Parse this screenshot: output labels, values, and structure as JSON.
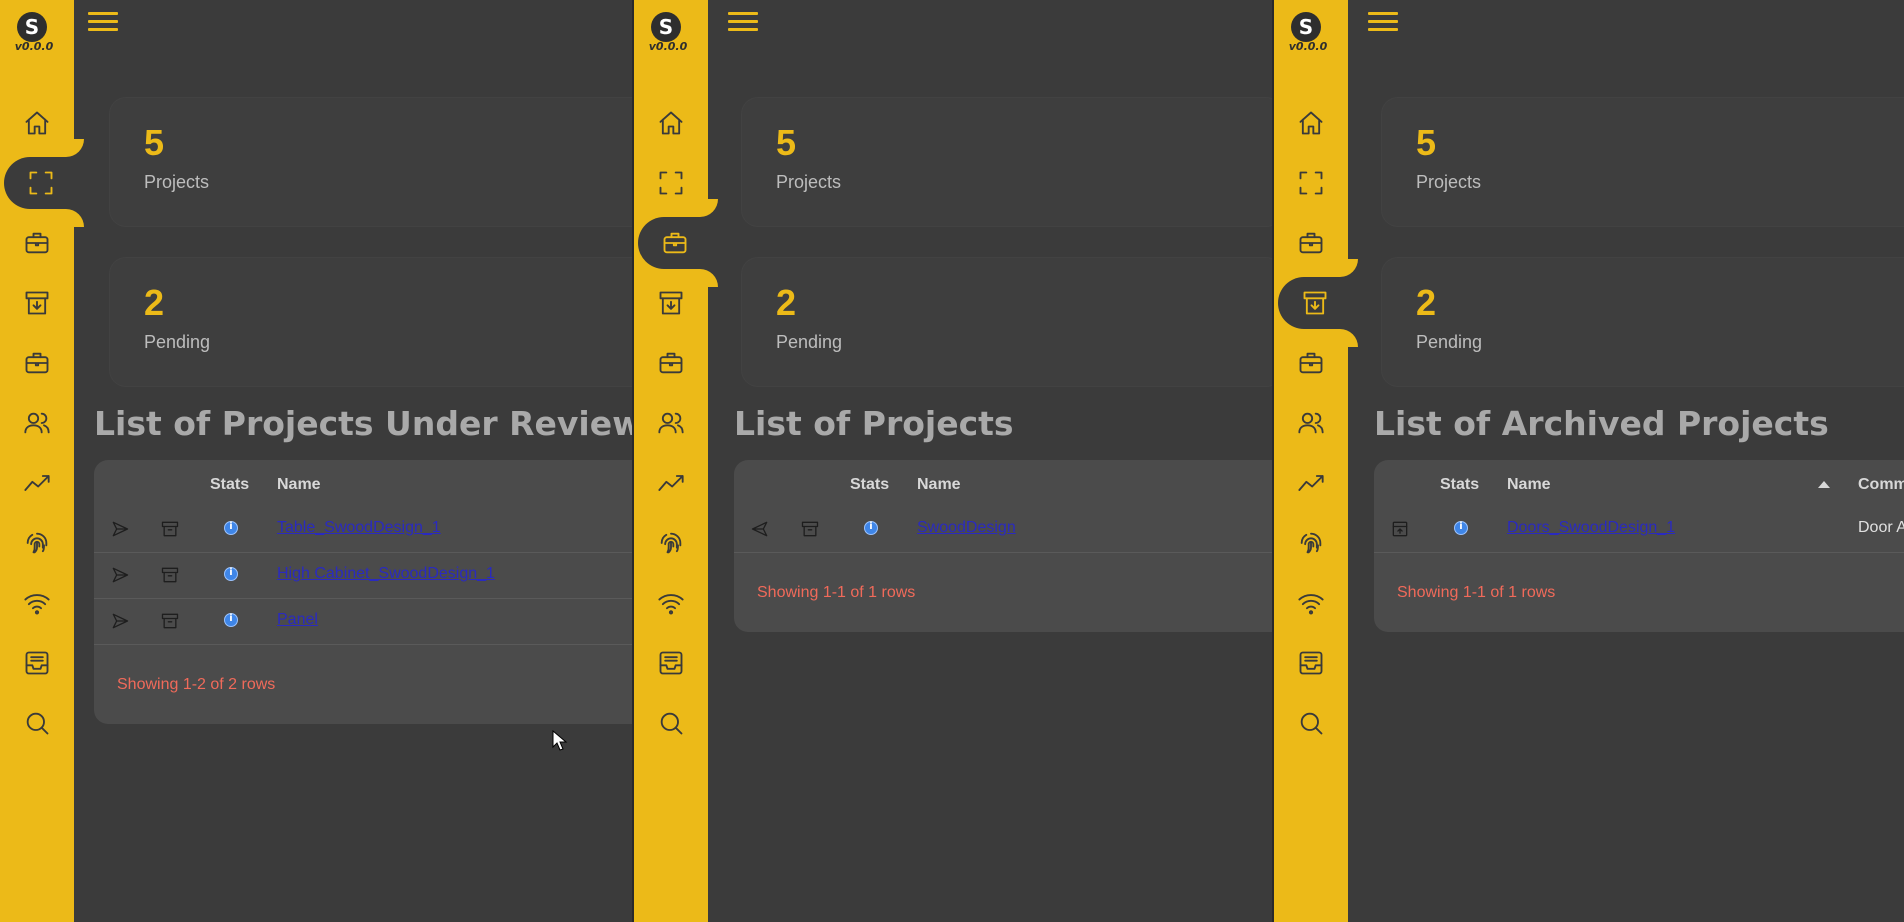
{
  "app": {
    "logo_letter": "S",
    "version": "v0.0.0"
  },
  "nav_icons": [
    "home-icon",
    "fullscreen-icon",
    "briefcase-icon",
    "archive-icon",
    "briefcase-icon",
    "users-icon",
    "chart-line-icon",
    "fingerprint-icon",
    "wifi-icon",
    "inbox-icon",
    "search-icon"
  ],
  "panels": [
    {
      "active_nav": 1,
      "stats": [
        {
          "value": "5",
          "label": "Projects"
        },
        {
          "value": "2",
          "label": "Pending"
        }
      ],
      "title": "List of Projects Under Review",
      "columns": {
        "stats": "Stats",
        "name": "Name"
      },
      "rows": [
        {
          "name": "Table_SwoodDesign_1"
        },
        {
          "name": "High Cabinet_SwoodDesign_1"
        },
        {
          "name": "Panel"
        }
      ],
      "showing": "Showing 1-2 of 2 rows"
    },
    {
      "active_nav": 2,
      "stats": [
        {
          "value": "5",
          "label": "Projects"
        },
        {
          "value": "2",
          "label": "Pending"
        }
      ],
      "title": "List of Projects",
      "columns": {
        "stats": "Stats",
        "name": "Name"
      },
      "rows": [
        {
          "name": "SwoodDesign"
        }
      ],
      "showing": "Showing 1-1 of 1 rows"
    },
    {
      "active_nav": 3,
      "stats": [
        {
          "value": "5",
          "label": "Projects"
        },
        {
          "value": "2",
          "label": "Pending"
        }
      ],
      "title": "List of Archived Projects",
      "columns": {
        "stats": "Stats",
        "name": "Name",
        "comment": "Comm"
      },
      "rows": [
        {
          "name": "Doors_SwoodDesign_1",
          "comment": "Door A"
        }
      ],
      "showing": "Showing 1-1 of 1 rows"
    }
  ],
  "colors": {
    "accent": "#ecba18",
    "background": "#3b3b3b",
    "table": "#4b4b4b",
    "link": "#2a2ac0",
    "footer_text": "#f06a5a"
  }
}
